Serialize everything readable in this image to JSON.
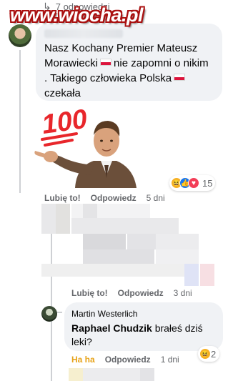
{
  "watermark": {
    "text": "www.wiocha.pl"
  },
  "thread": {
    "replies_label": "7 odpowiedzi"
  },
  "comment_1": {
    "text_line1": "Nasz Kochany Premier Mateusz",
    "text_line2a": "Morawiecki",
    "text_line2b": "nie zapomni o nikim",
    "text_line3": ". Takiego człowieka Polska",
    "text_line4": "czekała",
    "sticker_label": "100",
    "reaction_count": "15",
    "reactions": [
      "haha-icon",
      "like-icon",
      "love-icon"
    ],
    "actions": {
      "like": "Lubię to!",
      "reply": "Odpowiedz",
      "time": "5 dni"
    }
  },
  "comment_2": {
    "actions": {
      "like": "Lubię to!",
      "reply": "Odpowiedz",
      "time": "3 dni"
    }
  },
  "comment_3": {
    "author": "Martin Westerlich",
    "mention": "Raphael Chudzik",
    "text": "brałeś dziś leki?",
    "reaction_count": "2",
    "actions": {
      "reaction": "Ha ha",
      "reply": "Odpowiedz",
      "time": "1 dni"
    }
  },
  "colors": {
    "bubble": "#f0f2f5",
    "secondary_text": "#65676b",
    "haha": "#e7a218",
    "like": "#1877f2",
    "love": "#f33e58"
  }
}
